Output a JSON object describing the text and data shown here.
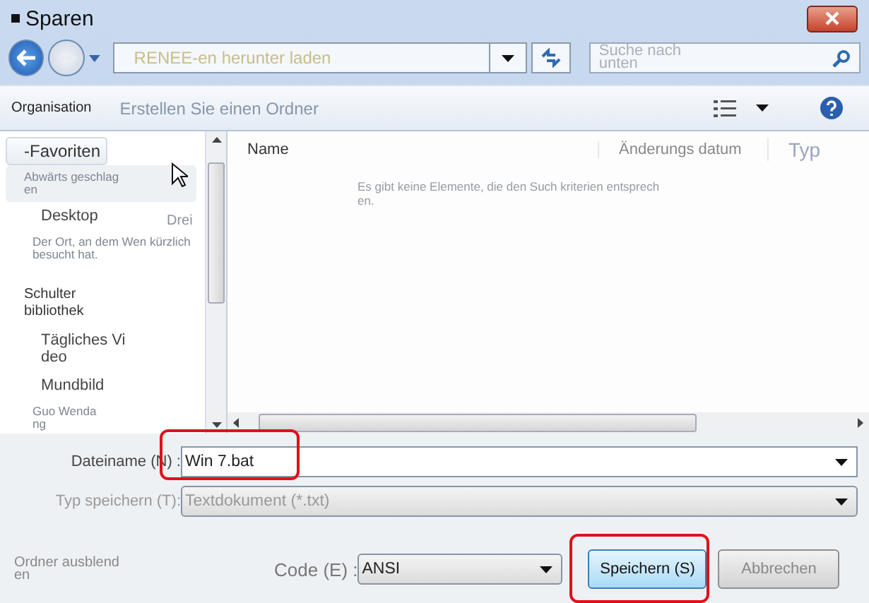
{
  "window": {
    "title": "Sparen"
  },
  "address": {
    "path": "RENEE-en herunter laden",
    "search": {
      "placeholder": "Suche nach unten"
    }
  },
  "toolbar": {
    "organize": "Organisation",
    "new_folder": "Erstellen Sie einen Ordner"
  },
  "sidebar": {
    "items": [
      {
        "kind": "group",
        "lines": [
          "-Favoriten"
        ],
        "selected": true
      },
      {
        "kind": "note",
        "lines": [
          "Abwärts geschlag",
          "en"
        ],
        "selected": false
      },
      {
        "kind": "item",
        "lines": [
          "Desktop"
        ],
        "selected": false
      },
      {
        "kind": "note",
        "lines": [
          "Der Ort, an dem Wen kürzlich",
          " besucht hat."
        ],
        "selected": false
      },
      {
        "kind": "group",
        "lines": [
          "Schulter",
          "bibliothek"
        ],
        "selected": false
      },
      {
        "kind": "sub",
        "lines": [
          "Tägliches Vi",
          "deo"
        ],
        "selected": false
      },
      {
        "kind": "item",
        "lines": [
          "Mundbild"
        ],
        "selected": false
      },
      {
        "kind": "note",
        "lines": [
          "Guo Wenda",
          "ng"
        ],
        "selected": false
      }
    ],
    "overlap_text": "Drei"
  },
  "file_list": {
    "columns": [
      "Name",
      "Änderungs datum",
      "Typ"
    ],
    "empty_message": [
      "Es gibt keine Elemente, die den Such kriterien entsprech",
      "en."
    ]
  },
  "form": {
    "filename": {
      "label": "Dateiname (N) :",
      "value": "Win 7.bat"
    },
    "filetype": {
      "label": "Typ speichern (T):",
      "value": "Textdokument (*.txt)"
    },
    "hide_folders": [
      "Ordner ausblend",
      "en"
    ],
    "encoding": {
      "label": "Code (E) :",
      "value": "ANSI"
    },
    "buttons": [
      {
        "label": "Speichern (S)",
        "kind": "default"
      },
      {
        "label": "Abbrechen",
        "kind": "normal"
      }
    ]
  }
}
